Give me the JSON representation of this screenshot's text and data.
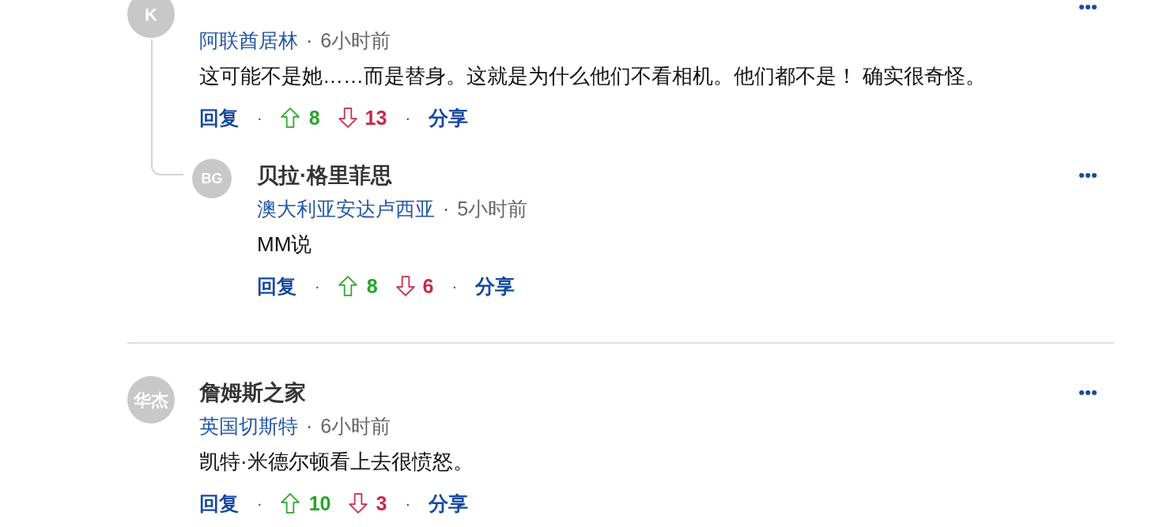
{
  "comments": [
    {
      "avatar": "K",
      "location": "阿联酋居林",
      "separator": "·",
      "time": "6小时前",
      "text": "这可能不是她……而是替身。这就是为什么他们不看相机。他们都不是！ 确实很奇怪。",
      "reply": "回复",
      "upvotes": "8",
      "downvotes": "13",
      "share": "分享",
      "action_separators": [
        "·",
        "·"
      ],
      "replies": [
        {
          "avatar": "BG",
          "name": "贝拉·格里菲思",
          "location": "澳大利亚安达卢西亚",
          "separator": "·",
          "time": "5小时前",
          "text": "MM说",
          "reply": "回复",
          "upvotes": "8",
          "downvotes": "6",
          "share": "分享",
          "action_separators": [
            "·",
            "·"
          ]
        }
      ]
    },
    {
      "avatar": "华杰",
      "name": "詹姆斯之家",
      "location": "英国切斯特",
      "separator": "·",
      "time": "6小时前",
      "text": "凯特·米德尔顿看上去很愤怒。",
      "reply": "回复",
      "upvotes": "10",
      "downvotes": "3",
      "share": "分享",
      "action_separators": [
        "·",
        "·"
      ]
    }
  ]
}
